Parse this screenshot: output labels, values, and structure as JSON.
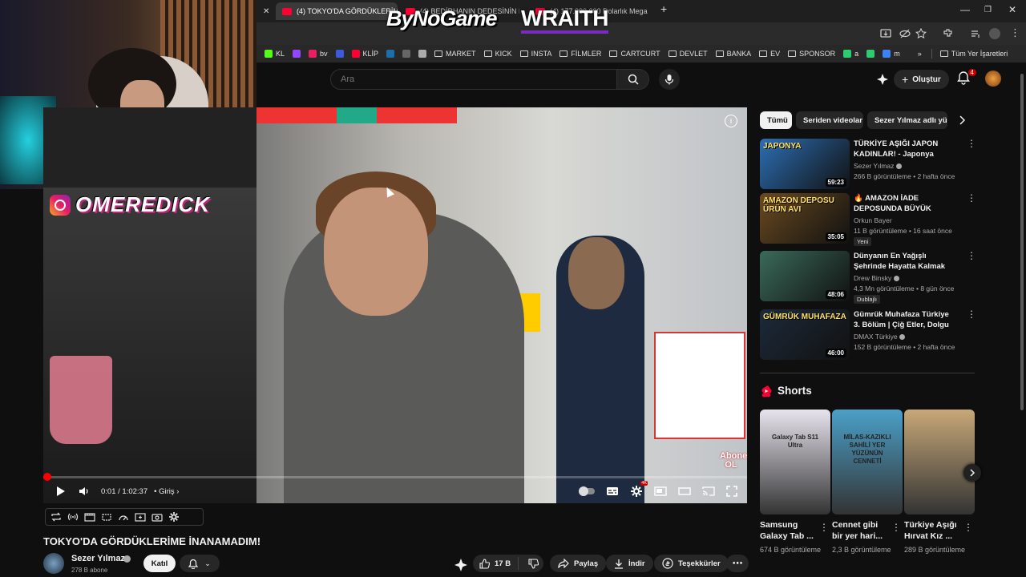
{
  "browser": {
    "tabs": [
      {
        "title": "(4) TOKYO'DA GÖRDÜKLERİMİ",
        "active": true
      },
      {
        "title": "(4) BEDİRHANIN DEDESİNİN EV",
        "active": false
      },
      {
        "title": "(4) 177.000.000 Dolarlık Mega",
        "active": false
      }
    ],
    "new_tab": "+",
    "window_controls": [
      "—",
      "❐",
      "✕"
    ],
    "bookmarks": [
      {
        "label": "KL",
        "icon": "kick-icon",
        "color": "#53fc18"
      },
      {
        "label": "",
        "icon": "twitch-icon",
        "color": "#9146ff"
      },
      {
        "label": "bv",
        "icon": "bv-icon",
        "color": "#e91e63"
      },
      {
        "label": "",
        "icon": "r-icon",
        "color": "#3b5bdb"
      },
      {
        "label": "KLİP",
        "icon": "youtube-icon",
        "color": "#ff0033"
      },
      {
        "label": "",
        "icon": "steam-icon",
        "color": "#1b6ea8"
      },
      {
        "label": "",
        "icon": "tab-icon",
        "color": "#666666"
      },
      {
        "label": "",
        "icon": "globe-icon",
        "color": "#aaaaaa"
      },
      {
        "label": "MARKET",
        "icon": "folder-icon"
      },
      {
        "label": "KICK",
        "icon": "folder-icon"
      },
      {
        "label": "INSTA",
        "icon": "folder-icon"
      },
      {
        "label": "FİLMLER",
        "icon": "folder-icon"
      },
      {
        "label": "CARTCURT",
        "icon": "folder-icon"
      },
      {
        "label": "DEVLET",
        "icon": "folder-icon"
      },
      {
        "label": "BANKA",
        "icon": "folder-icon"
      },
      {
        "label": "EV",
        "icon": "folder-icon"
      },
      {
        "label": "SPONSOR",
        "icon": "folder-icon"
      },
      {
        "label": "a",
        "icon": "green-icon",
        "color": "#2ecc71"
      },
      {
        "label": "",
        "icon": "sparkle-icon",
        "color": "#2ecc71"
      },
      {
        "label": "m",
        "icon": "meta-icon",
        "color": "#3b82f6"
      }
    ],
    "overflow": "»",
    "all_bookmarks": "Tüm Yer İşaretleri"
  },
  "overlay": {
    "sponsor1": "ByNoGame",
    "sponsor2": "WRAITH",
    "instagram_label": "INSTAGRAM",
    "instagram_handle": "OMEREDICK"
  },
  "masthead": {
    "search_placeholder": "Ara",
    "create_label": "Oluştur",
    "notification_count": "4"
  },
  "player": {
    "time": "0:01 / 1:02:37",
    "chapter": "• Giriş",
    "progress_fraction": 0.0003,
    "watermark": "Abone OL",
    "settings_badge": "4K"
  },
  "video": {
    "title": "TOKYO'DA GÖRDÜKLERİME İNANAMADIM!",
    "channel": "Sezer Yılmaz",
    "subscribers": "278 B abone",
    "join_label": "Katıl",
    "likes": "17 B",
    "share_label": "Paylaş",
    "download_label": "İndir",
    "thanks_label": "Teşekkürler"
  },
  "sidebar": {
    "chips": [
      "Tümü",
      "Seriden videolar",
      "Sezer Yılmaz adlı yük"
    ],
    "recommendations": [
      {
        "title": "TÜRKİYE AŞIĞI JAPON KADINLAR! - Japonya Tokyo: ...",
        "channel": "Sezer Yılmaz",
        "verified": true,
        "views": "266 B görüntüleme",
        "age": "2 hafta önce",
        "duration": "59:23",
        "badge": "",
        "thumb_text": "JAPONYA",
        "thumb_color": "#2c6fb5"
      },
      {
        "title": "🔥 AMAZON İADE DEPOSUNDA BÜYÜK VURGUN! 🔥 Dolarlar ...",
        "channel": "Orkun Bayer",
        "verified": false,
        "views": "11 B görüntüleme",
        "age": "16 saat önce",
        "duration": "35:05",
        "badge": "Yeni",
        "thumb_text": "AMAZON DEPOSU ÜRÜN AVI",
        "thumb_color": "#6a4a20"
      },
      {
        "title": "Dünyanın En Yağışlı Şehrinde Hayatta Kalmak (Her Gün ...",
        "channel": "Drew Binsky",
        "verified": true,
        "views": "4,3 Mn görüntüleme",
        "age": "8 gün önce",
        "duration": "48:06",
        "badge": "Dublajlı",
        "thumb_text": "",
        "thumb_color": "#3a6a5a"
      },
      {
        "title": "Gümrük Muhafaza Türkiye 3. Bölüm | Çiğ Etler, Dolgu ...",
        "channel": "DMAX Türkiye",
        "verified": true,
        "views": "152 B görüntüleme",
        "age": "2 hafta önce",
        "duration": "46:00",
        "badge": "",
        "thumb_text": "GÜMRÜK MUHAFAZA",
        "thumb_color": "#1c2a3a"
      }
    ],
    "shorts_title": "Shorts",
    "shorts": [
      {
        "title": "Samsung Galaxy Tab ...",
        "views": "674 B görüntüleme",
        "thumb_text": "Galaxy Tab S11 Ultra",
        "thumb_color": "#e8e4ee"
      },
      {
        "title": "Cennet gibi bir yer hari...",
        "views": "2,3 B görüntüleme",
        "thumb_text": "MİLAS-KAZIKLI SAHİLİ YER YÜZÜNÜN CENNETİ",
        "thumb_color": "#4aa0c8"
      },
      {
        "title": "Türkiye Aşığı Hırvat Kız ...",
        "views": "289 B görüntüleme",
        "thumb_text": "",
        "thumb_color": "#c8a878"
      }
    ]
  }
}
